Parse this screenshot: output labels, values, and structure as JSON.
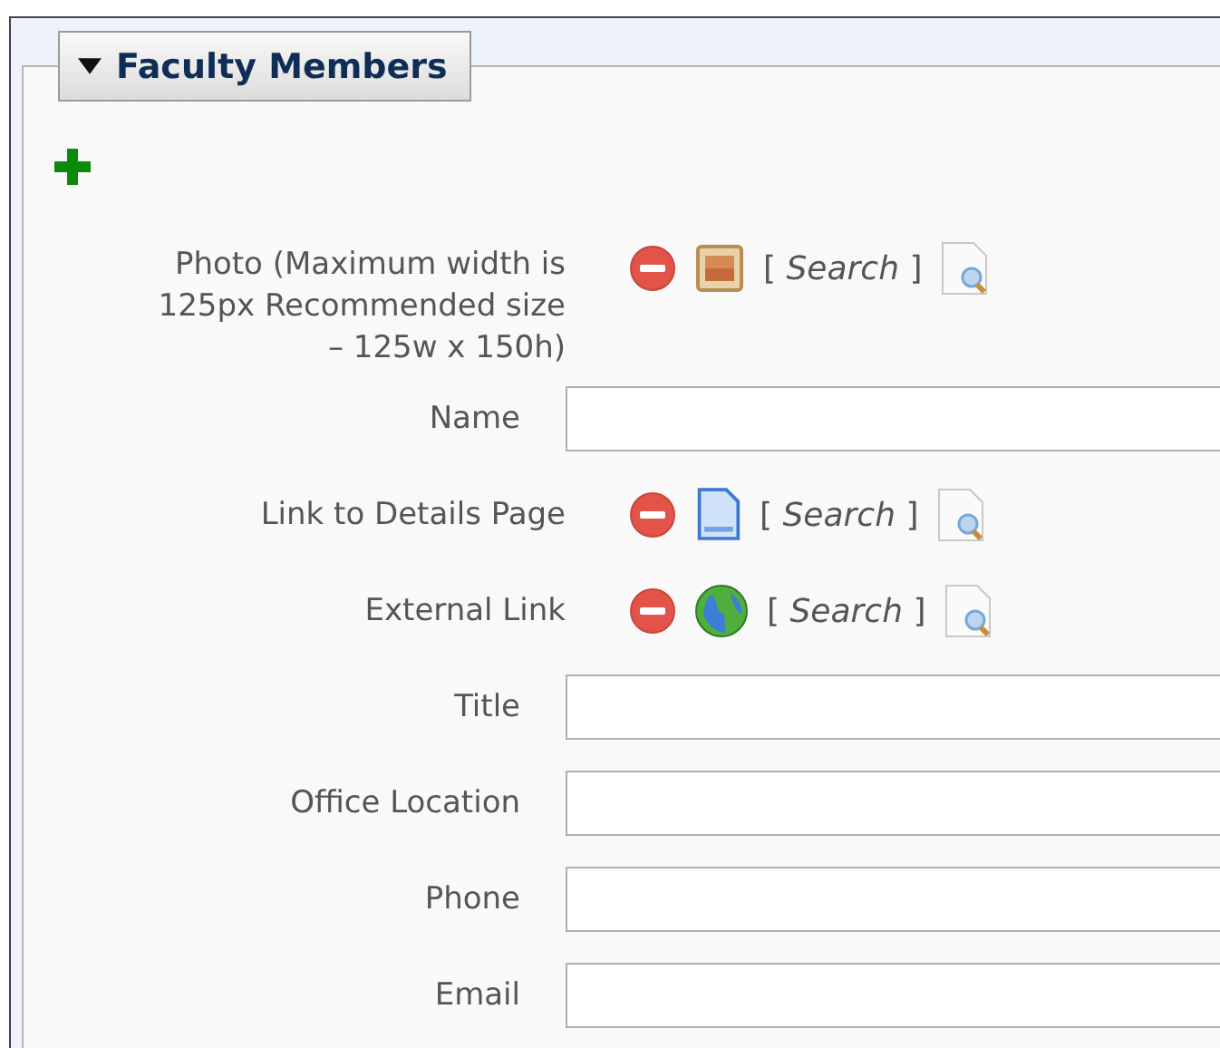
{
  "section": {
    "title": "Faculty Members",
    "expanded": true
  },
  "fields": [
    {
      "kind": "picker",
      "label": "Photo (Maximum width is 125px Recommended size – 125w x 150h)",
      "target": {
        "kind": "image"
      },
      "search": "[ *Search* ]"
    },
    {
      "kind": "text",
      "label": "Name"
    },
    {
      "kind": "picker",
      "label": "Link to Details Page",
      "target": {
        "kind": "page"
      },
      "search": "[ *Search* ]"
    },
    {
      "kind": "picker",
      "label": "External Link",
      "target": {
        "kind": "globe"
      },
      "search": "[ *Search* ]"
    },
    {
      "kind": "text",
      "label": "Title"
    },
    {
      "kind": "text",
      "label": "Office Location"
    },
    {
      "kind": "text",
      "label": "Phone"
    },
    {
      "kind": "text",
      "label": "Email"
    }
  ]
}
